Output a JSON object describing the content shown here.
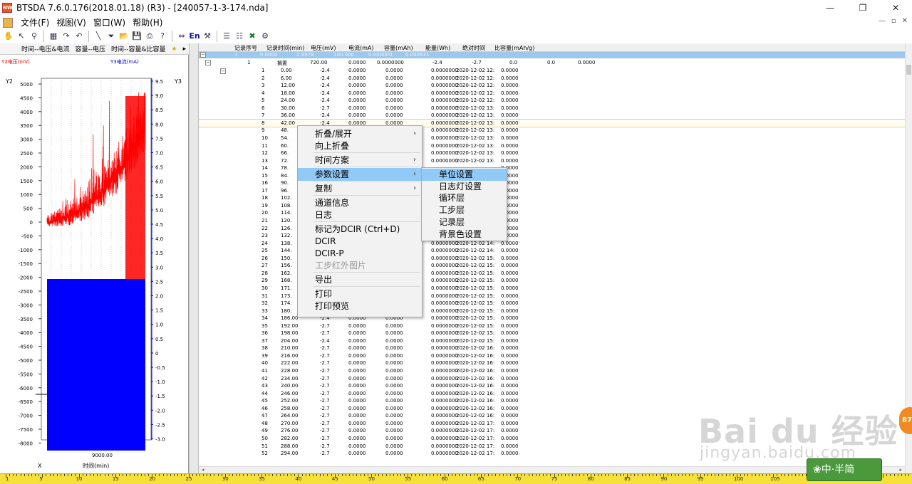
{
  "window": {
    "title": "BTSDA 7.6.0.176(2018.01.18) (R3) - [240057-1-3-174.nda]",
    "app_icon": "NW",
    "minimize": "—",
    "restore": "❐",
    "close": "✕"
  },
  "menubar": {
    "items": [
      "文件(F)",
      "视图(V)",
      "窗口(W)",
      "帮助(H)"
    ],
    "mdi": [
      "—",
      "▫",
      "✕"
    ]
  },
  "toolbar": {
    "icons": [
      "hand-icon",
      "pointer-icon",
      "zoom-icon",
      "grid-icon",
      "redo-icon",
      "undo-icon",
      "line-icon",
      "filter-icon",
      "open-icon",
      "save-icon",
      "print-icon",
      "help-icon",
      "left-right-icon",
      "language-icon",
      "tools-icon",
      "table-icon",
      "excel-icon",
      "settings-icon"
    ],
    "language_label": "En"
  },
  "chart_tabs": [
    "时间--电压&电流",
    "容量--电压",
    "时间--容量&比容量",
    "★",
    "▸",
    "✚"
  ],
  "chart": {
    "y2_label": "Y2电压(mV)",
    "y3_label": "Y3电流(mA)",
    "y2_axis": "Y2",
    "y3_axis": "Y3",
    "x_axis": "X",
    "x_label": "时间(min)",
    "x_tick": "9000.00",
    "y2_ticks": [
      "5000",
      "4500",
      "4000",
      "3500",
      "3000",
      "2500",
      "2000",
      "1500",
      "1000",
      "500",
      "0",
      "-500",
      "-1000",
      "-1500",
      "-2000",
      "-2500",
      "-3000",
      "-3500",
      "-4000",
      "-4500",
      "-5000",
      "-5500",
      "-6000",
      "-6500",
      "-7000",
      "-7500",
      "-8000"
    ],
    "y3_ticks": [
      "9.5",
      "9.0",
      "8.5",
      "8.0",
      "7.5",
      "7.0",
      "6.5",
      "6.0",
      "5.5",
      "5.0",
      "4.5",
      "4.0",
      "3.5",
      "3.0",
      "2.5",
      "2.0",
      "1.5",
      "1.0",
      "0.5",
      "0",
      "-0.5",
      "-1.0",
      "-1.5",
      "-2.0",
      "-2.5",
      "-3.0"
    ],
    "voltage_color": "#ff0000",
    "current_color": "#0000ff"
  },
  "grid": {
    "columns": [
      "记录序号",
      "记录时间(min)",
      "电压(mV)",
      "电流(mA)",
      "容量(mAh)",
      "能量(Wh)",
      "绝对时间",
      "比容量(mAh/g)"
    ],
    "top_row": [
      "1",
      "0.0000",
      "2.9978",
      "100.000",
      "0.000000",
      "0.000631"
    ],
    "step_row": [
      "1",
      "搁置",
      "720.00",
      "0.0000",
      "0.0000000",
      "-2.4",
      "-2.7",
      "0.0",
      "0.0",
      "0.0000"
    ],
    "rows": [
      [
        "1",
        "0.00",
        "-2.4",
        "0.0000",
        "0.0000",
        "0.0000000",
        "2020-12-02 12:",
        "0.0000"
      ],
      [
        "2",
        "6.00",
        "-2.4",
        "0.0000",
        "0.0000",
        "0.0000000",
        "2020-12-02 12:",
        "0.0000"
      ],
      [
        "3",
        "12.00",
        "-2.4",
        "0.0000",
        "0.0000",
        "0.0000000",
        "2020-12-02 12:",
        "0.0000"
      ],
      [
        "4",
        "18.00",
        "-2.4",
        "0.0000",
        "0.0000",
        "0.0000000",
        "2020-12-02 12:",
        "0.0000"
      ],
      [
        "5",
        "24.00",
        "-2.4",
        "0.0000",
        "0.0000",
        "0.0000000",
        "2020-12-02 12:",
        "0.0000"
      ],
      [
        "6",
        "30.00",
        "-2.7",
        "0.0000",
        "0.0000",
        "0.0000000",
        "2020-12-02 13:",
        "0.0000"
      ],
      [
        "7",
        "36.00",
        "-2.4",
        "0.0000",
        "0.0000",
        "0.0000000",
        "2020-12-02 13:",
        "0.0000"
      ],
      [
        "8",
        "42.00",
        "-2.4",
        "0.0000",
        "0.0000",
        "0.0000000",
        "2020-12-02 13:",
        "0.0000"
      ],
      [
        "9",
        "48.",
        "",
        "",
        "",
        "0.0000000",
        "2020-12-02 13:",
        "0.0000"
      ],
      [
        "10",
        "54.",
        "",
        "",
        "",
        "0.0000000",
        "2020-12-02 13:",
        "0.0000"
      ],
      [
        "11",
        "60.",
        "",
        "",
        "",
        "0.0000000",
        "2020-12-02 13:",
        "0.0000"
      ],
      [
        "12",
        "66.",
        "",
        "",
        "",
        "0.0000000",
        "2020-12-02 13:",
        "0.0000"
      ],
      [
        "13",
        "72.",
        "",
        "",
        "",
        "0.0000000",
        "2020-12-02 13:",
        "0.0000"
      ],
      [
        "14",
        "78.",
        "",
        "",
        "",
        "",
        "",
        "0.0000"
      ],
      [
        "15",
        "84.",
        "",
        "",
        "",
        "",
        "",
        "0.0000"
      ],
      [
        "16",
        "90.",
        "",
        "",
        "",
        "",
        "",
        "0.0000"
      ],
      [
        "17",
        "96.",
        "",
        "",
        "",
        "",
        "",
        "0.0000"
      ],
      [
        "18",
        "102.",
        "",
        "",
        "",
        "",
        "",
        "0.0000"
      ],
      [
        "19",
        "108.",
        "",
        "",
        "",
        "",
        "",
        "0.0000"
      ],
      [
        "20",
        "114.",
        "",
        "",
        "",
        "",
        "",
        "0.0000"
      ],
      [
        "21",
        "120.",
        "",
        "",
        "",
        "",
        "",
        "0.0000"
      ],
      [
        "22",
        "126.",
        "",
        "",
        "",
        "",
        "",
        "0.0000"
      ],
      [
        "23",
        "132.",
        "",
        "",
        "",
        "",
        "",
        "0.0000"
      ],
      [
        "24",
        "138.",
        "",
        "",
        "",
        "0.0000000",
        "2020-12-02 14:",
        "0.0000"
      ],
      [
        "25",
        "144.",
        "",
        "",
        "",
        "0.0000000",
        "2020-12-02 14:",
        "0.0000"
      ],
      [
        "26",
        "150.",
        "",
        "",
        "",
        "0.0000000",
        "2020-12-02 15:",
        "0.0000"
      ],
      [
        "27",
        "156.",
        "",
        "",
        "",
        "0.0000000",
        "2020-12-02 15:",
        "0.0000"
      ],
      [
        "28",
        "162.",
        "",
        "",
        "",
        "0.0000000",
        "2020-12-02 15:",
        "0.0000"
      ],
      [
        "29",
        "168.",
        "",
        "",
        "",
        "0.0000000",
        "2020-12-02 15:",
        "0.0000"
      ],
      [
        "30",
        "171.",
        "",
        "",
        "",
        "0.0000000",
        "2020-12-02 15:",
        "0.0000"
      ],
      [
        "31",
        "173.",
        "",
        "",
        "",
        "0.0000000",
        "2020-12-02 15:",
        "0.0000"
      ],
      [
        "32",
        "174.",
        "",
        "",
        "",
        "0.0000000",
        "2020-12-02 15:",
        "0.0000"
      ],
      [
        "33",
        "180.",
        "",
        "",
        "",
        "0.0000000",
        "2020-12-02 15:",
        "0.0000"
      ],
      [
        "34",
        "186.00",
        "-2.4",
        "0.0000",
        "0.0000",
        "0.0000000",
        "2020-12-02 15:",
        "0.0000"
      ],
      [
        "35",
        "192.00",
        "-2.7",
        "0.0000",
        "0.0000",
        "0.0000000",
        "2020-12-02 15:",
        "0.0000"
      ],
      [
        "36",
        "198.00",
        "-2.7",
        "0.0000",
        "0.0000",
        "0.0000000",
        "2020-12-02 15:",
        "0.0000"
      ],
      [
        "37",
        "204.00",
        "-2.4",
        "0.0000",
        "0.0000",
        "0.0000000",
        "2020-12-02 15:",
        "0.0000"
      ],
      [
        "38",
        "210.00",
        "-2.7",
        "0.0000",
        "0.0000",
        "0.0000000",
        "2020-12-02 16:",
        "0.0000"
      ],
      [
        "39",
        "216.00",
        "-2.7",
        "0.0000",
        "0.0000",
        "0.0000000",
        "2020-12-02 16:",
        "0.0000"
      ],
      [
        "40",
        "222.00",
        "-2.7",
        "0.0000",
        "0.0000",
        "0.0000000",
        "2020-12-02 16:",
        "0.0000"
      ],
      [
        "41",
        "228.00",
        "-2.7",
        "0.0000",
        "0.0000",
        "0.0000000",
        "2020-12-02 16:",
        "0.0000"
      ],
      [
        "42",
        "234.00",
        "-2.7",
        "0.0000",
        "0.0000",
        "0.0000000",
        "2020-12-02 16:",
        "0.0000"
      ],
      [
        "43",
        "240.00",
        "-2.7",
        "0.0000",
        "0.0000",
        "0.0000000",
        "2020-12-02 16:",
        "0.0000"
      ],
      [
        "44",
        "246.00",
        "-2.7",
        "0.0000",
        "0.0000",
        "0.0000000",
        "2020-12-02 16:",
        "0.0000"
      ],
      [
        "45",
        "252.00",
        "-2.7",
        "0.0000",
        "0.0000",
        "0.0000000",
        "2020-12-02 16:",
        "0.0000"
      ],
      [
        "46",
        "258.00",
        "-2.7",
        "0.0000",
        "0.0000",
        "0.0000000",
        "2020-12-02 16:",
        "0.0000"
      ],
      [
        "47",
        "264.00",
        "-2.7",
        "0.0000",
        "0.0000",
        "0.0000000",
        "2020-12-02 16:",
        "0.0000"
      ],
      [
        "48",
        "270.00",
        "-2.7",
        "0.0000",
        "0.0000",
        "0.0000000",
        "2020-12-02 17:",
        "0.0000"
      ],
      [
        "49",
        "276.00",
        "-2.7",
        "0.0000",
        "0.0000",
        "0.0000000",
        "2020-12-02 17:",
        "0.0000"
      ],
      [
        "50",
        "282.00",
        "-2.7",
        "0.0000",
        "0.0000",
        "0.0000000",
        "2020-12-02 17:",
        "0.0000"
      ],
      [
        "51",
        "288.00",
        "-2.7",
        "0.0000",
        "0.0000",
        "0.0000000",
        "2020-12-02 17:",
        "0.0000"
      ],
      [
        "52",
        "294.00",
        "-2.7",
        "0.0000",
        "0.0000",
        "0.0000000",
        "2020-12-02 17:",
        "0.0000"
      ]
    ]
  },
  "context_menu": {
    "items": [
      {
        "label": "折叠/展开",
        "submenu": true
      },
      {
        "label": "向上折叠"
      },
      {
        "sep": true
      },
      {
        "label": "时间方案",
        "submenu": true
      },
      {
        "sep": true
      },
      {
        "label": "参数设置",
        "submenu": true,
        "highlight": true
      },
      {
        "sep": true
      },
      {
        "label": "复制",
        "submenu": true
      },
      {
        "sep": true
      },
      {
        "label": "通道信息"
      },
      {
        "label": "日志"
      },
      {
        "sep": true
      },
      {
        "label": "标记为DCIR (Ctrl+D)"
      },
      {
        "label": "DCIR"
      },
      {
        "label": "DCIR-P"
      },
      {
        "label": "工步红外图片",
        "disabled": true
      },
      {
        "sep": true
      },
      {
        "label": "导出"
      },
      {
        "sep": true
      },
      {
        "label": "打印"
      },
      {
        "label": "打印预览"
      }
    ]
  },
  "submenu": {
    "items": [
      "单位设置",
      "日志灯设置",
      "循环层",
      "工步层",
      "记录层",
      "背景色设置"
    ],
    "highlight_index": 0
  },
  "ruler": [
    "1",
    "5",
    "10",
    "15",
    "20",
    "25",
    "30",
    "35",
    "40",
    "45",
    "50",
    "55",
    "60",
    "65",
    "70",
    "75",
    "80",
    "85",
    "90",
    "95",
    "100",
    "105",
    "110"
  ],
  "watermark": {
    "logo": "Bai du 经验",
    "sub": "jingyan.baidu.com"
  },
  "side_badge": "87",
  "ime": "❀中·半简"
}
